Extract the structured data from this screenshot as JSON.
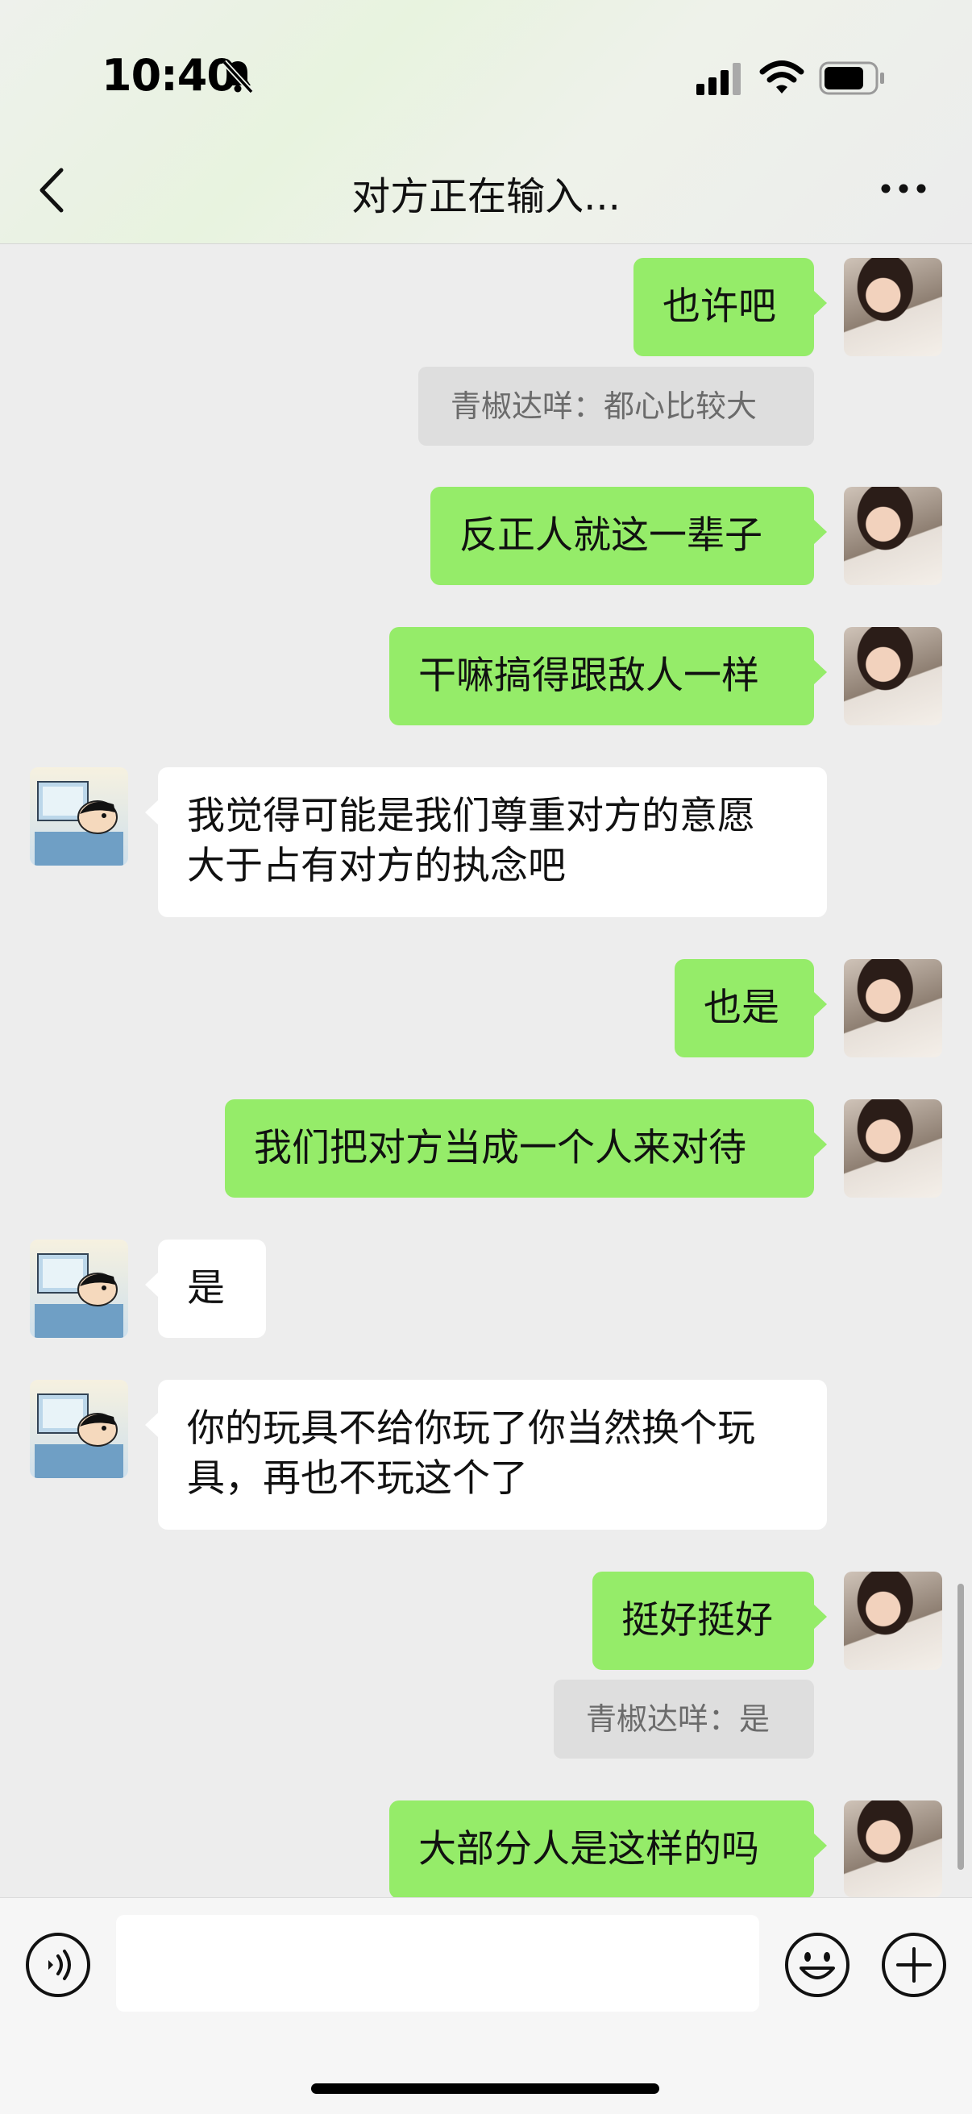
{
  "status_bar": {
    "time": "10:40"
  },
  "header": {
    "title": "对方正在输入..."
  },
  "messages": [
    {
      "side": "me",
      "text": "也许吧"
    },
    {
      "side": "quote",
      "text": "青椒达咩：都心比较大"
    },
    {
      "side": "me",
      "text": "反正人就这一辈子"
    },
    {
      "side": "me",
      "text": "干嘛搞得跟敌人一样"
    },
    {
      "side": "them",
      "line1": "我觉得可能是我们尊重对方的意愿",
      "line2": "大于占有对方的执念吧"
    },
    {
      "side": "me",
      "text": "也是"
    },
    {
      "side": "me",
      "text": "我们把对方当成一个人来对待"
    },
    {
      "side": "them",
      "text": "是"
    },
    {
      "side": "them",
      "line1": "你的玩具不给你玩了你当然换个玩",
      "line2": "具，再也不玩这个了"
    },
    {
      "side": "me",
      "text": "挺好挺好"
    },
    {
      "side": "quote",
      "text": "青椒达咩：是"
    },
    {
      "side": "me",
      "text": "大部分人是这样的吗"
    }
  ],
  "input_bar": {
    "text": ""
  },
  "icons": [
    "back-icon",
    "more-icon",
    "voice-icon",
    "emoji-icon",
    "plus-icon",
    "bell-slash-icon",
    "signal-icon",
    "wifi-icon",
    "battery-icon"
  ],
  "colors": {
    "my_bubble": "#95ec69",
    "their_bubble": "#ffffff",
    "background": "#ededed",
    "quote_bg": "#dedede"
  }
}
